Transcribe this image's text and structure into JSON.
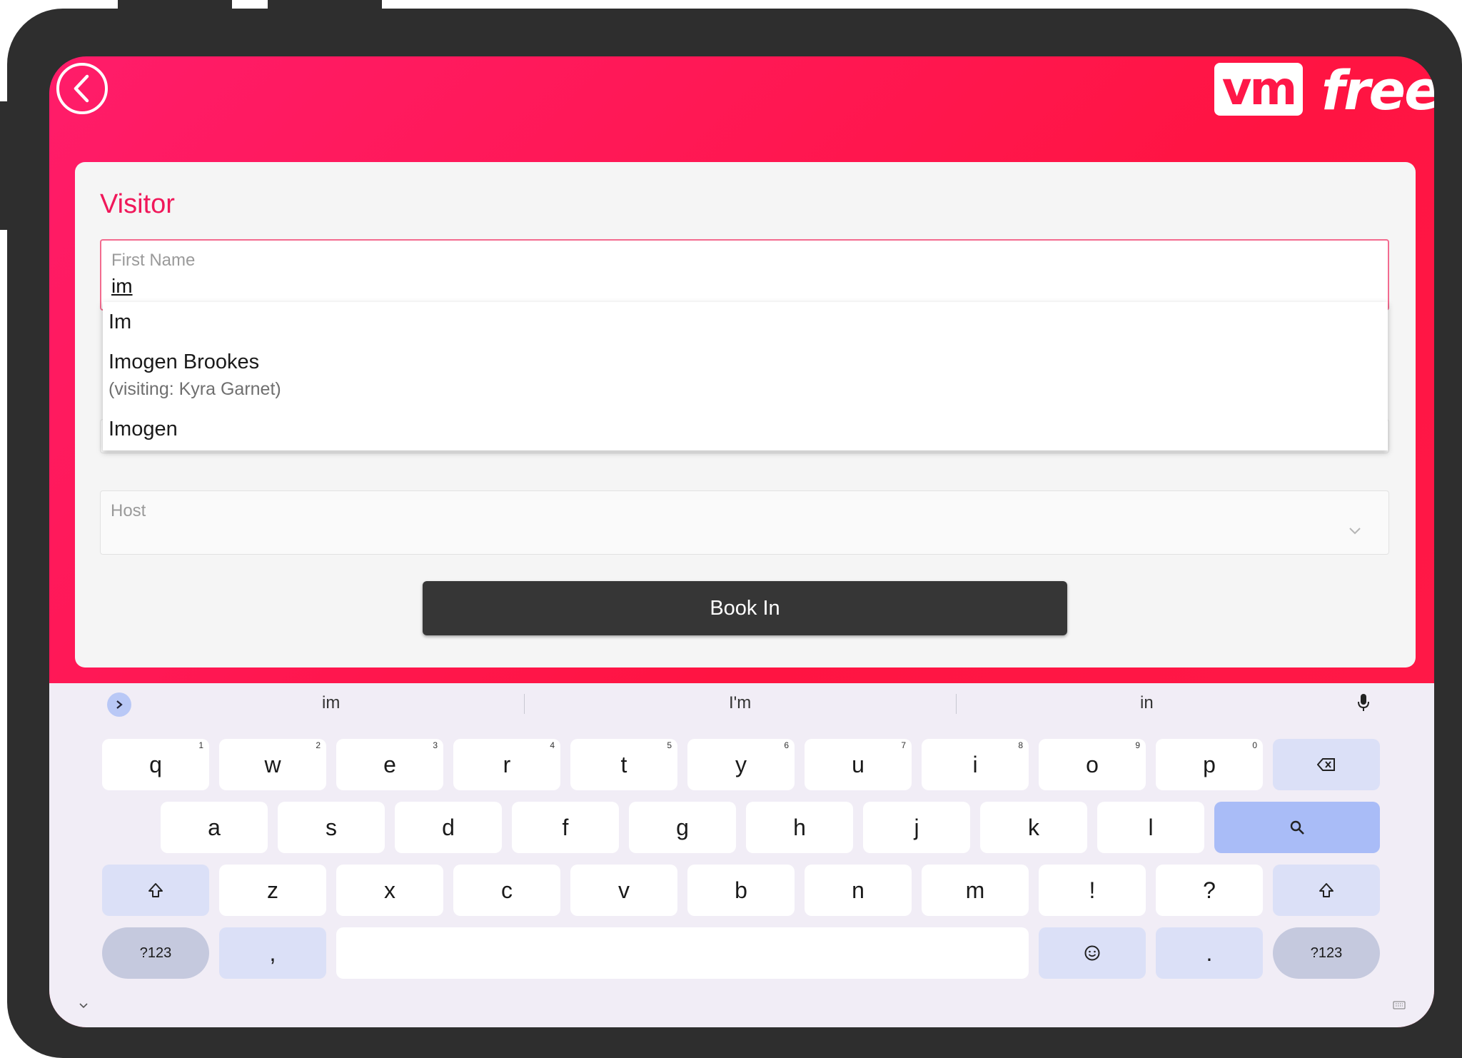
{
  "header": {
    "back_icon": "chevron-left-icon",
    "logo": {
      "badge": "vm",
      "word": "free"
    }
  },
  "form": {
    "title": "Visitor",
    "first_name": {
      "label": "First Name",
      "value": "im"
    },
    "host": {
      "label": "Host",
      "value": ""
    },
    "submit_label": "Book In"
  },
  "autocomplete": {
    "items": [
      {
        "name": "Im",
        "detail": ""
      },
      {
        "name": "Imogen Brookes",
        "detail": "(visiting: Kyra Garnet)"
      },
      {
        "name": "Imogen",
        "detail": ""
      }
    ]
  },
  "keyboard": {
    "suggestions": [
      "im",
      "I'm",
      "in"
    ],
    "row1": [
      {
        "k": "q",
        "n": "1"
      },
      {
        "k": "w",
        "n": "2"
      },
      {
        "k": "e",
        "n": "3"
      },
      {
        "k": "r",
        "n": "4"
      },
      {
        "k": "t",
        "n": "5"
      },
      {
        "k": "y",
        "n": "6"
      },
      {
        "k": "u",
        "n": "7"
      },
      {
        "k": "i",
        "n": "8"
      },
      {
        "k": "o",
        "n": "9"
      },
      {
        "k": "p",
        "n": "0"
      }
    ],
    "row2": [
      "a",
      "s",
      "d",
      "f",
      "g",
      "h",
      "j",
      "k",
      "l"
    ],
    "row3": [
      "z",
      "x",
      "c",
      "v",
      "b",
      "n",
      "m",
      "!",
      "?"
    ],
    "symbols_label": "?123",
    "comma": ",",
    "period": ".",
    "icons": [
      "backspace-icon",
      "search-icon",
      "shift-icon",
      "emoji-icon",
      "mic-icon"
    ]
  },
  "colors": {
    "accent": "#ff1748",
    "title": "#f0185a",
    "button": "#363636"
  }
}
